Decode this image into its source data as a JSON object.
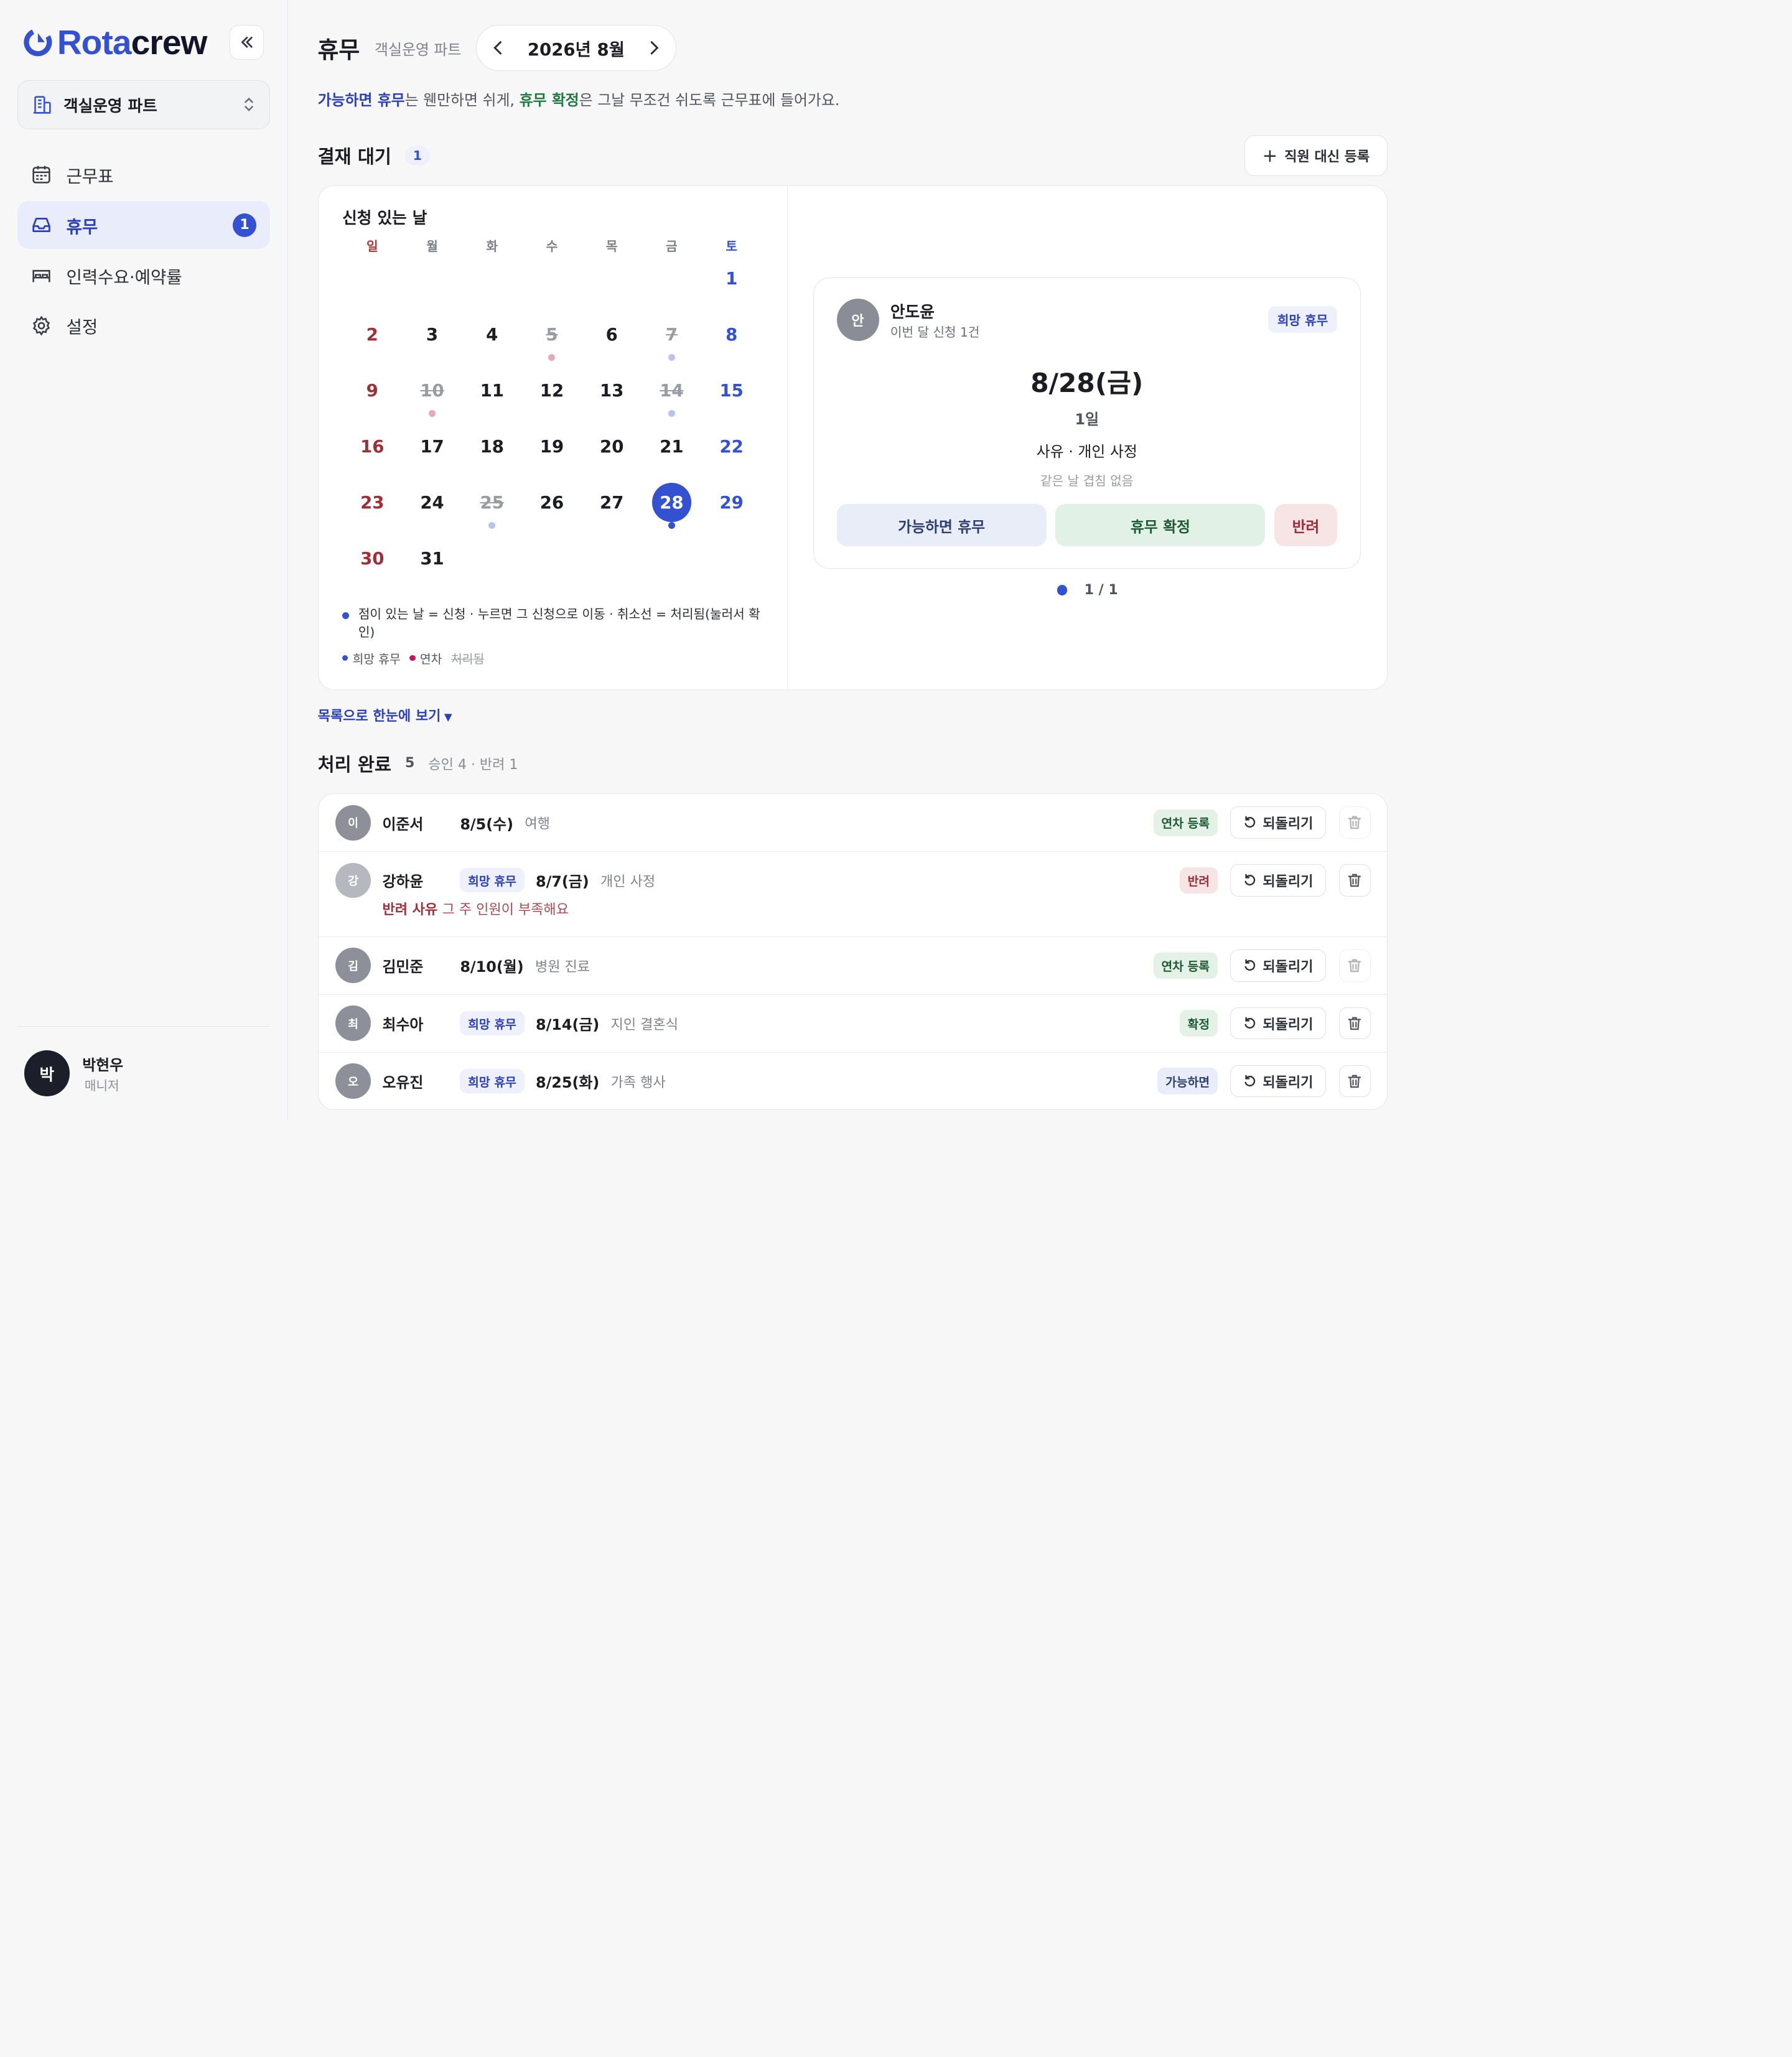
{
  "brand": {
    "part1": "Rota",
    "part2": "crew"
  },
  "org": {
    "name": "객실운영 파트"
  },
  "nav": [
    {
      "label": "근무표",
      "icon": "calendar-icon",
      "active": false
    },
    {
      "label": "휴무",
      "icon": "inbox-icon",
      "active": true,
      "badge": "1"
    },
    {
      "label": "인력수요·예약률",
      "icon": "bed-icon",
      "active": false
    },
    {
      "label": "설정",
      "icon": "gear-icon",
      "active": false
    }
  ],
  "user": {
    "initial": "박",
    "name": "박현우",
    "role": "매니저"
  },
  "header": {
    "title": "휴무",
    "subtitle": "객실운영 파트",
    "month": "2026년 8월"
  },
  "hint": {
    "b1": "가능하면 휴무",
    "t1": "는 웬만하면 쉬게, ",
    "b2": "휴무 확정",
    "t2": "은 그날 무조건 쉬도록 근무표에 들어가요."
  },
  "pending": {
    "title": "결재 대기",
    "count": "1",
    "proxy_label": "직원 대신 등록"
  },
  "calendar": {
    "title": "신청 있는 날",
    "dow": [
      "일",
      "월",
      "화",
      "수",
      "목",
      "금",
      "토"
    ],
    "days": [
      {
        "d": "",
        "k": ""
      },
      {
        "d": "",
        "k": ""
      },
      {
        "d": "",
        "k": ""
      },
      {
        "d": "",
        "k": ""
      },
      {
        "d": "",
        "k": ""
      },
      {
        "d": "",
        "k": ""
      },
      {
        "d": "1",
        "k": "sat"
      },
      {
        "d": "2",
        "k": "sun"
      },
      {
        "d": "3",
        "k": ""
      },
      {
        "d": "4",
        "k": ""
      },
      {
        "d": "5",
        "k": "done",
        "dot": "pink"
      },
      {
        "d": "6",
        "k": ""
      },
      {
        "d": "7",
        "k": "done",
        "dot": "lilac"
      },
      {
        "d": "8",
        "k": "sat"
      },
      {
        "d": "9",
        "k": "sun"
      },
      {
        "d": "10",
        "k": "done",
        "dot": "pink"
      },
      {
        "d": "11",
        "k": ""
      },
      {
        "d": "12",
        "k": ""
      },
      {
        "d": "13",
        "k": ""
      },
      {
        "d": "14",
        "k": "done",
        "dot": "lilac"
      },
      {
        "d": "15",
        "k": "sat"
      },
      {
        "d": "16",
        "k": "sun"
      },
      {
        "d": "17",
        "k": ""
      },
      {
        "d": "18",
        "k": ""
      },
      {
        "d": "19",
        "k": ""
      },
      {
        "d": "20",
        "k": ""
      },
      {
        "d": "21",
        "k": ""
      },
      {
        "d": "22",
        "k": "sat"
      },
      {
        "d": "23",
        "k": "sun"
      },
      {
        "d": "24",
        "k": ""
      },
      {
        "d": "25",
        "k": "done",
        "dot": "lilac"
      },
      {
        "d": "26",
        "k": ""
      },
      {
        "d": "27",
        "k": ""
      },
      {
        "d": "28",
        "k": "selected",
        "dot": "blue"
      },
      {
        "d": "29",
        "k": "sat"
      },
      {
        "d": "30",
        "k": "sun"
      },
      {
        "d": "31",
        "k": ""
      }
    ],
    "legend_main": "점이 있는 날 = 신청 · 누르면 그 신청으로 이동 · 취소선 = 처리됨(눌러서 확인)",
    "legend_wish": "희망 휴무",
    "legend_leave": "연차",
    "legend_done": "처리됨",
    "colors": {
      "wish": "#3451d1",
      "leave": "#c2185b"
    }
  },
  "request": {
    "initial": "안",
    "name": "안도윤",
    "meta": "이번 달 신청 1건",
    "tag": "희망 휴무",
    "date": "8/28(금)",
    "days": "1일",
    "reason": "사유 · 개인 사정",
    "overlap": "같은 날 겹침 없음",
    "btn_maybe": "가능하면 휴무",
    "btn_confirm": "휴무 확정",
    "btn_reject": "반려",
    "pager": "1 / 1"
  },
  "list_toggle": "목록으로 한눈에 보기",
  "done": {
    "title": "처리 완료",
    "count": "5",
    "summary": "승인 4 · 반려 1",
    "undo_label": "되돌리기",
    "rows": [
      {
        "initial": "이",
        "name": "이준서",
        "tag": "",
        "date": "8/5(수)",
        "reason": "여행",
        "status": "연차 등록",
        "status_kind": "leave",
        "trash_enabled": false
      },
      {
        "initial": "강",
        "name": "강하윤",
        "tag": "희망 휴무",
        "date": "8/7(금)",
        "reason": "개인 사정",
        "status": "반려",
        "status_kind": "reject",
        "trash_enabled": true,
        "note_label": "반려 사유",
        "note": "그 주 인원이 부족해요"
      },
      {
        "initial": "김",
        "name": "김민준",
        "tag": "",
        "date": "8/10(월)",
        "reason": "병원 진료",
        "status": "연차 등록",
        "status_kind": "leave",
        "trash_enabled": false
      },
      {
        "initial": "최",
        "name": "최수아",
        "tag": "희망 휴무",
        "date": "8/14(금)",
        "reason": "지인 결혼식",
        "status": "확정",
        "status_kind": "confirm",
        "trash_enabled": true
      },
      {
        "initial": "오",
        "name": "오유진",
        "tag": "희망 휴무",
        "date": "8/25(화)",
        "reason": "가족 행사",
        "status": "가능하면",
        "status_kind": "maybe",
        "trash_enabled": true
      }
    ]
  }
}
